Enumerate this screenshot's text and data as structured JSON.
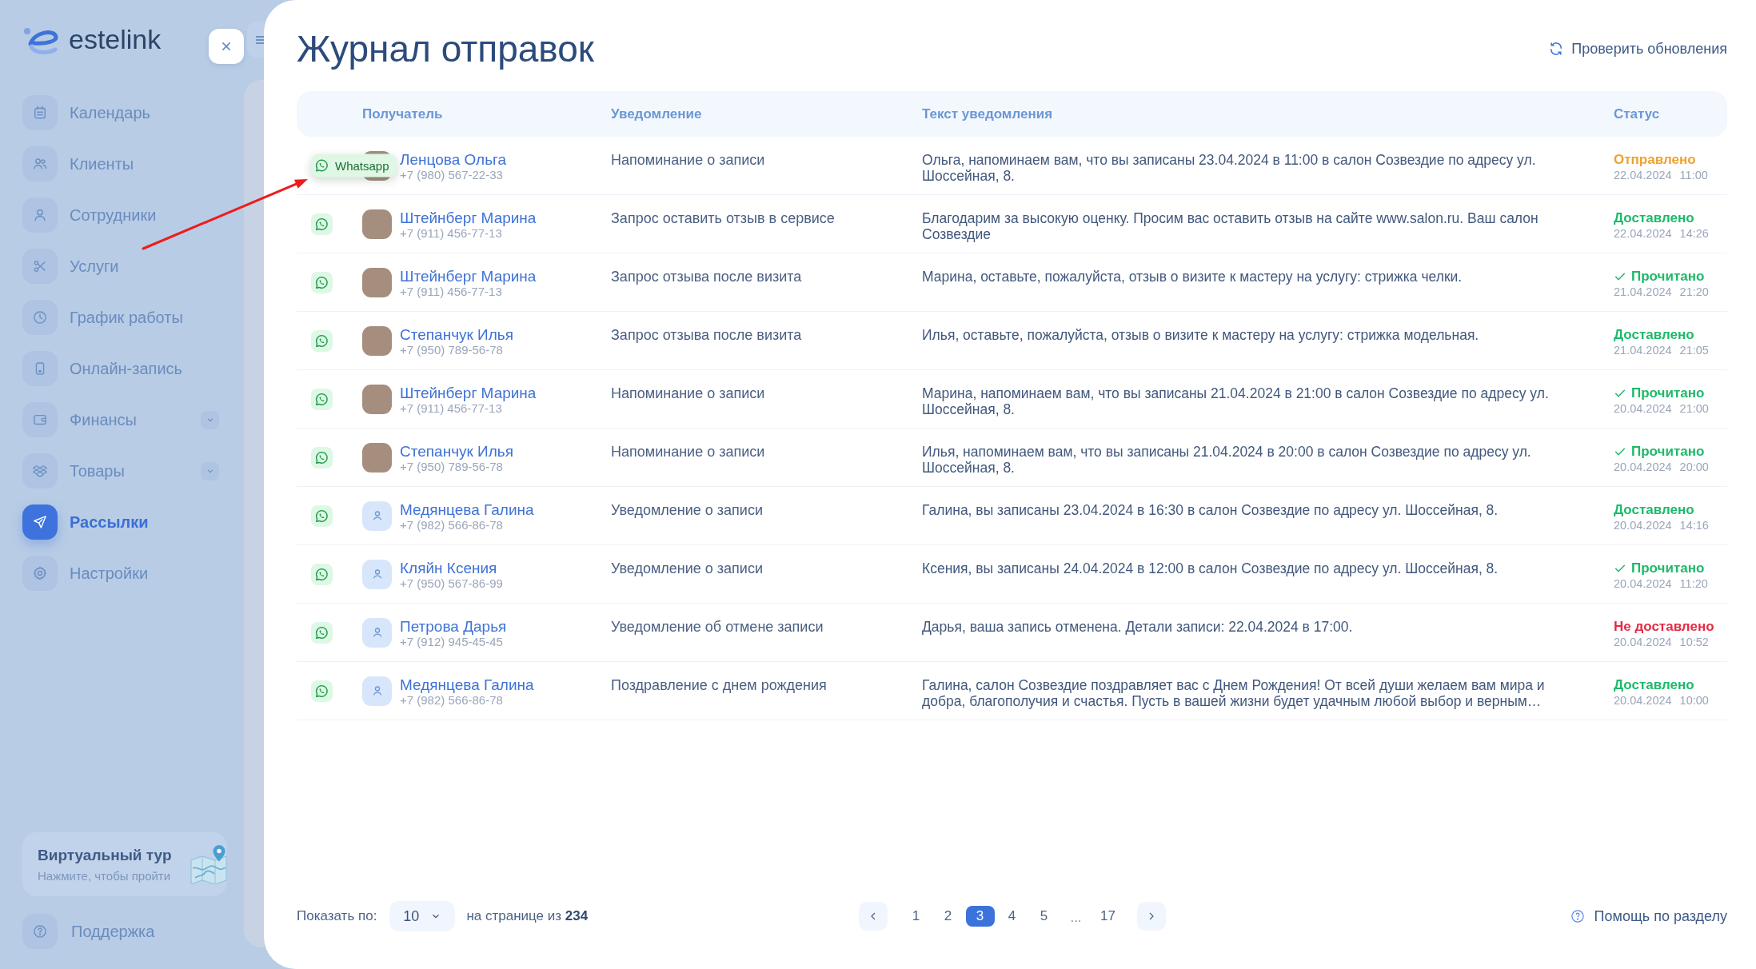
{
  "sidebar": {
    "brand": "estelink",
    "items": [
      {
        "label": "Календарь",
        "kind": "link",
        "selected": false
      },
      {
        "label": "Клиенты",
        "kind": "link",
        "selected": false
      },
      {
        "label": "Сотрудники",
        "kind": "link",
        "selected": false
      },
      {
        "label": "Услуги",
        "kind": "link",
        "selected": false
      },
      {
        "label": "График работы",
        "kind": "link",
        "selected": false
      },
      {
        "label": "Онлайн-запись",
        "kind": "link",
        "selected": false
      },
      {
        "label": "Финансы",
        "kind": "group",
        "selected": false
      },
      {
        "label": "Товары",
        "kind": "group",
        "selected": false
      },
      {
        "label": "Рассылки",
        "kind": "link",
        "selected": true
      },
      {
        "label": "Настройки",
        "kind": "link",
        "selected": false
      }
    ],
    "tour": {
      "title": "Виртуальный тур",
      "subtitle": "Нажмите, чтобы пройти"
    },
    "support": "Поддержка"
  },
  "page": {
    "title": "Журнал отправок",
    "refresh_action": "Проверить обновления"
  },
  "table": {
    "columns": [
      "Получатель",
      "Уведомление",
      "Текст уведомления",
      "Статус"
    ],
    "rows": [
      {
        "channel_tooltip": "Whatsapp",
        "name": "Ленцова Ольга",
        "phone": "+7 (980) 567-22-33",
        "avatar": {
          "kind": "photo"
        },
        "notification": "Напоминание о записи",
        "message": "Ольга, напоминаем вам, что вы записаны 23.04.2024 в 11:00 в салон Созвездие по адресу ул. Шоссейная, 8.",
        "status": {
          "kind": "sent",
          "label": "Отправлено",
          "date": "22.04.2024",
          "time": "11:00"
        }
      },
      {
        "name": "Штейнберг Марина",
        "phone": "+7 (911) 456-77-13",
        "avatar": {
          "kind": "photo"
        },
        "notification": "Запрос оставить отзыв в сервисе",
        "message": "Благодарим за высокую оценку. Просим вас оставить отзыв на сайте www.salon.ru. Ваш салон Созвездие",
        "status": {
          "kind": "delivered",
          "label": "Доставлено",
          "date": "22.04.2024",
          "time": "14:26"
        }
      },
      {
        "name": "Штейнберг Марина",
        "phone": "+7 (911) 456-77-13",
        "avatar": {
          "kind": "photo"
        },
        "notification": "Запрос отзыва после визита",
        "message": "Марина, оставьте, пожалуйста, отзыв о визите к мастеру на услугу: стрижка челки.",
        "status": {
          "kind": "read",
          "label": "Прочитано",
          "date": "21.04.2024",
          "time": "21:20"
        }
      },
      {
        "name": "Степанчук Илья",
        "phone": "+7 (950) 789-56-78",
        "avatar": {
          "kind": "photo"
        },
        "notification": "Запрос отзыва после визита",
        "message": "Илья, оставьте, пожалуйста, отзыв о визите к мастеру на услугу: стрижка модельная.",
        "status": {
          "kind": "delivered",
          "label": "Доставлено",
          "date": "21.04.2024",
          "time": "21:05"
        }
      },
      {
        "name": "Штейнберг Марина",
        "phone": "+7 (911) 456-77-13",
        "avatar": {
          "kind": "photo"
        },
        "notification": "Напоминание о записи",
        "message": "Марина, напоминаем вам, что вы записаны 21.04.2024 в 21:00 в салон Созвездие по адресу ул. Шоссейная, 8.",
        "status": {
          "kind": "read",
          "label": "Прочитано",
          "date": "20.04.2024",
          "time": "21:00"
        }
      },
      {
        "name": "Степанчук Илья",
        "phone": "+7 (950) 789-56-78",
        "avatar": {
          "kind": "photo"
        },
        "notification": "Напоминание о записи",
        "message": "Илья, напоминаем вам, что вы записаны 21.04.2024 в 20:00 в салон Созвездие по адресу ул. Шоссейная, 8.",
        "status": {
          "kind": "read",
          "label": "Прочитано",
          "date": "20.04.2024",
          "time": "20:00"
        }
      },
      {
        "name": "Медянцева Галина",
        "phone": "+7 (982) 566-86-78",
        "avatar": {
          "kind": "placeholder"
        },
        "notification": "Уведомление о записи",
        "message": "Галина, вы записаны 23.04.2024 в 16:30 в салон Созвездие по адресу ул. Шоссейная, 8.",
        "status": {
          "kind": "delivered",
          "label": "Доставлено",
          "date": "20.04.2024",
          "time": "14:16"
        }
      },
      {
        "name": "Кляйн Ксения",
        "phone": "+7 (950) 567-86-99",
        "avatar": {
          "kind": "placeholder"
        },
        "notification": "Уведомление о записи",
        "message": "Ксения, вы записаны 24.04.2024 в 12:00 в салон Созвездие по адресу ул. Шоссейная, 8.",
        "status": {
          "kind": "read",
          "label": "Прочитано",
          "date": "20.04.2024",
          "time": "11:20"
        }
      },
      {
        "name": "Петрова Дарья",
        "phone": "+7 (912) 945-45-45",
        "avatar": {
          "kind": "placeholder"
        },
        "notification": "Уведомление об отмене записи",
        "message": "Дарья, ваша запись отменена. Детали записи: 22.04.2024 в 17:00.",
        "status": {
          "kind": "failed",
          "label": "Не доставлено",
          "date": "20.04.2024",
          "time": "10:52"
        }
      },
      {
        "name": "Медянцева Галина",
        "phone": "+7 (982) 566-86-78",
        "avatar": {
          "kind": "placeholder"
        },
        "notification": "Поздравление с днем рождения",
        "message": "Галина, салон Созвездие поздравляет вас с Днем Рождения! От всей души желаем вам мира и добра, благополучия и счастья. Пусть в вашей жизни будет удачным любой выбор и верным…",
        "status": {
          "kind": "delivered",
          "label": "Доставлено",
          "date": "20.04.2024",
          "time": "10:00"
        }
      }
    ]
  },
  "pagination": {
    "page_size_label": "Показать по:",
    "page_size": "10",
    "range_text": "на странице из **234**",
    "pages": [
      {
        "label": "1",
        "kind": "page",
        "selected": false
      },
      {
        "label": "2",
        "kind": "page",
        "selected": false
      },
      {
        "label": "3",
        "kind": "page",
        "selected": true
      },
      {
        "label": "4",
        "kind": "page",
        "selected": false
      },
      {
        "label": "5",
        "kind": "page",
        "selected": false
      },
      {
        "label": "...",
        "kind": "ellipsis",
        "selected": false
      },
      {
        "label": "17",
        "kind": "page",
        "selected": false
      }
    ],
    "help_link": "Помощь по разделу"
  }
}
